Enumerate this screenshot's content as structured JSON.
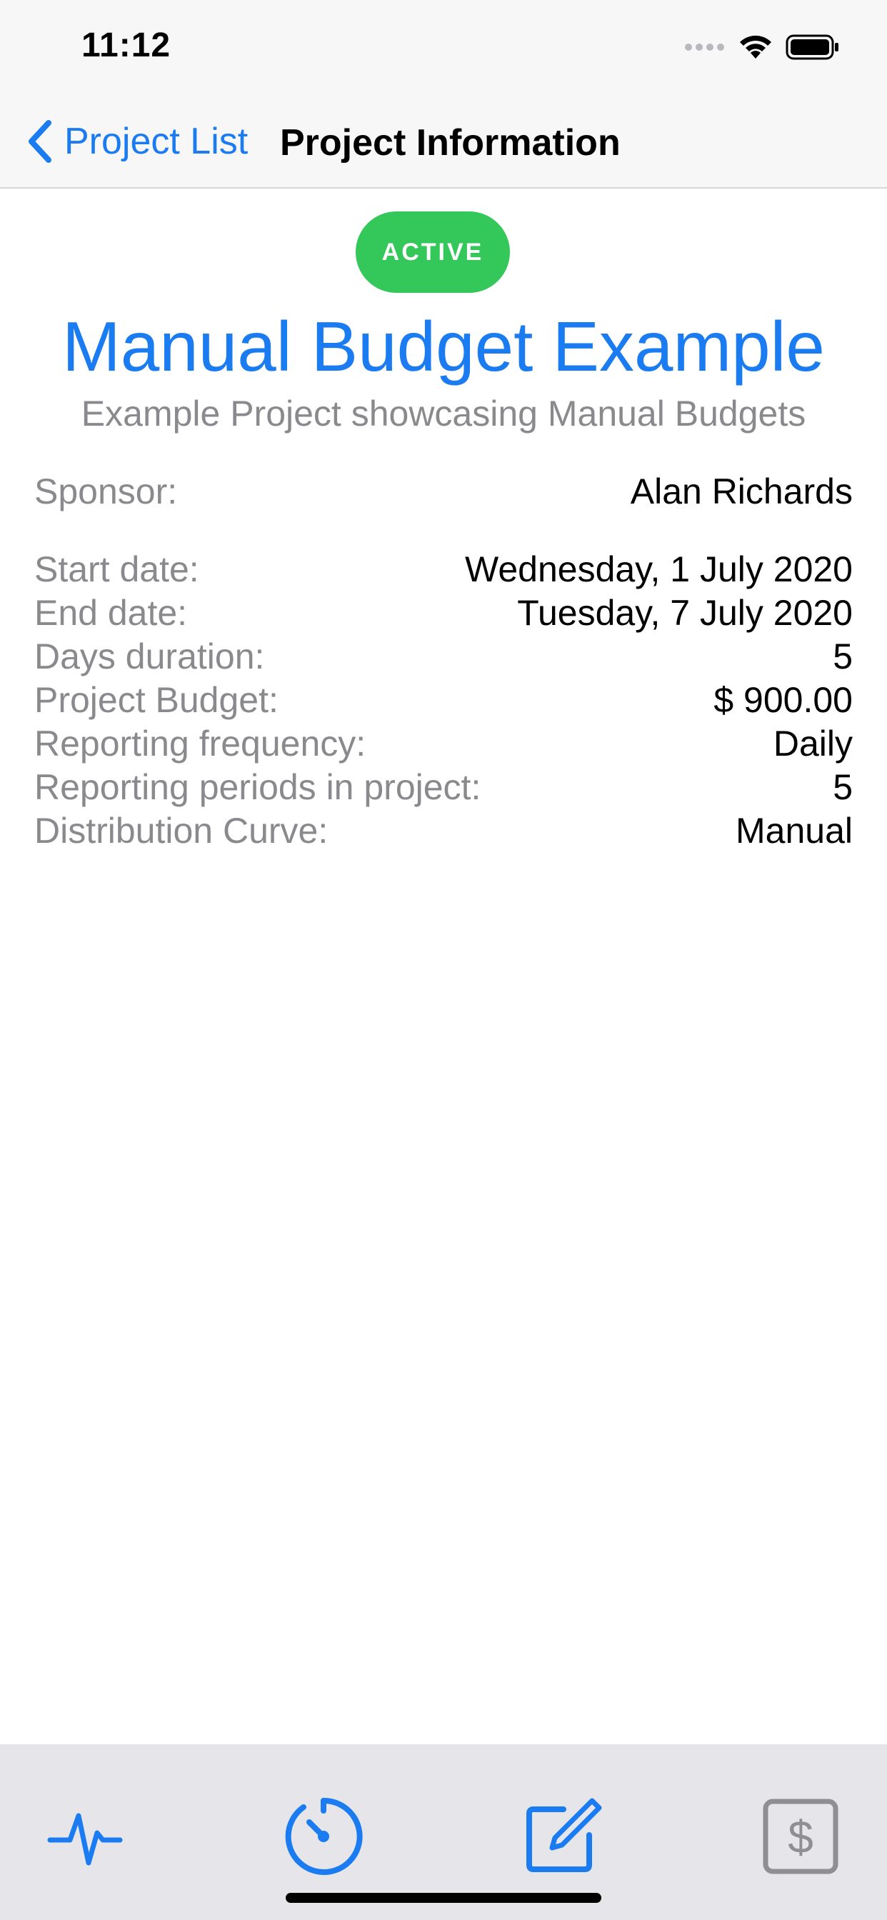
{
  "status_bar": {
    "time": "11:12"
  },
  "nav": {
    "back_label": "Project List",
    "title": "Project Information"
  },
  "project": {
    "status": "ACTIVE",
    "name": "Manual Budget Example",
    "description": "Example Project showcasing Manual Budgets"
  },
  "details": {
    "sponsor": {
      "label": "Sponsor:",
      "value": "Alan Richards"
    },
    "start_date": {
      "label": "Start date:",
      "value": "Wednesday, 1 July 2020"
    },
    "end_date": {
      "label": "End date:",
      "value": "Tuesday, 7 July 2020"
    },
    "days_duration": {
      "label": "Days duration:",
      "value": "5"
    },
    "project_budget": {
      "label": "Project Budget:",
      "value": "$ 900.00"
    },
    "reporting_frequency": {
      "label": "Reporting frequency:",
      "value": "Daily"
    },
    "reporting_periods": {
      "label": "Reporting periods in project:",
      "value": "5"
    },
    "distribution_curve": {
      "label": "Distribution Curve:",
      "value": "Manual"
    }
  },
  "tab_bar": {
    "tabs": [
      {
        "icon": "activity-pulse-icon"
      },
      {
        "icon": "timer-dial-icon"
      },
      {
        "icon": "edit-compose-icon"
      },
      {
        "icon": "dollar-box-icon"
      }
    ]
  },
  "colors": {
    "accent": "#1a7cf0",
    "active_badge": "#34c759",
    "secondary_text": "#8a8a8e",
    "disabled_icon": "#8e8e93"
  }
}
